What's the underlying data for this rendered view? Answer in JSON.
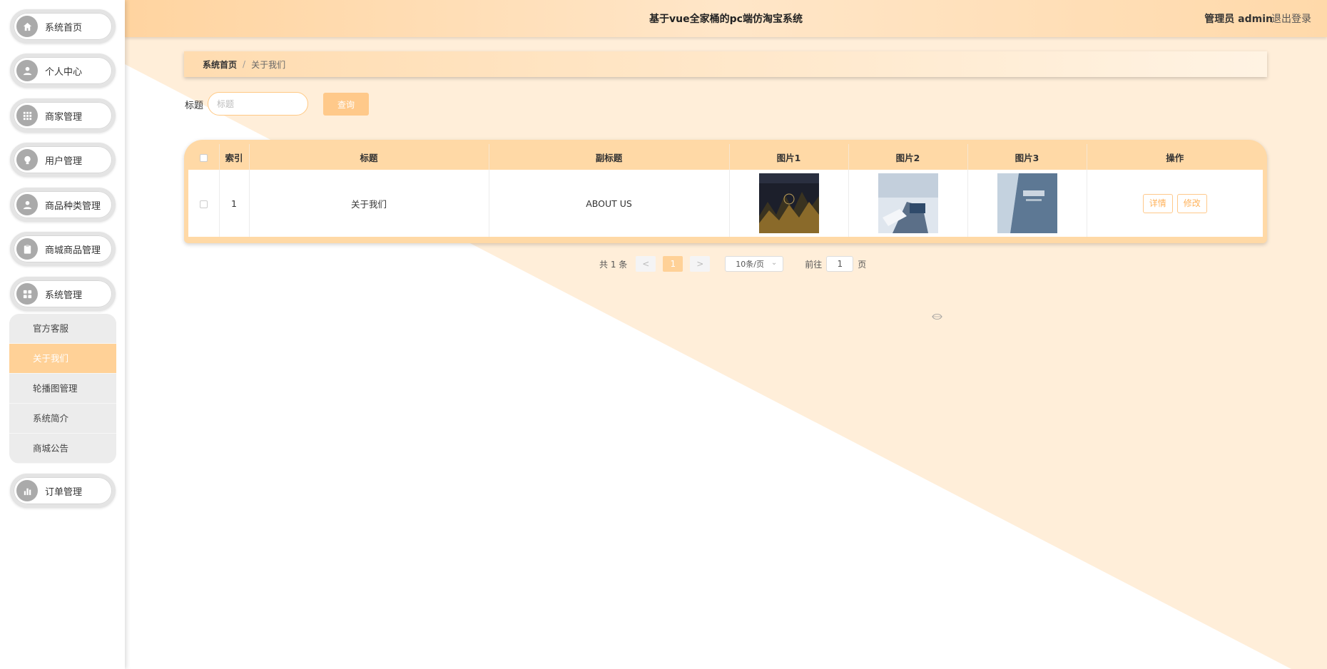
{
  "header": {
    "title": "基于vue全家桶的pc端仿淘宝系统",
    "user": "管理员 admin",
    "logout": "退出登录"
  },
  "sidebar": {
    "items": [
      {
        "label": "系统首页",
        "icon": "home-icon"
      },
      {
        "label": "个人中心",
        "icon": "user-icon"
      },
      {
        "label": "商家管理",
        "icon": "grid-icon"
      },
      {
        "label": "用户管理",
        "icon": "bulb-icon"
      },
      {
        "label": "商品种类管理",
        "icon": "user-icon"
      },
      {
        "label": "商城商品管理",
        "icon": "clipboard-icon"
      },
      {
        "label": "系统管理",
        "icon": "apps-icon"
      },
      {
        "label": "订单管理",
        "icon": "bar-chart-icon"
      }
    ],
    "submenu": [
      {
        "label": "官方客服"
      },
      {
        "label": "关于我们",
        "active": true
      },
      {
        "label": "轮播图管理"
      },
      {
        "label": "系统简介"
      },
      {
        "label": "商城公告"
      }
    ]
  },
  "breadcrumb": {
    "home": "系统首页",
    "separator": "/",
    "current": "关于我们"
  },
  "search": {
    "label": "标题",
    "placeholder": "标题",
    "button": "查询"
  },
  "table": {
    "columns": [
      "索引",
      "标题",
      "副标题",
      "图片1",
      "图片2",
      "图片3",
      "操作"
    ],
    "rows": [
      {
        "index": "1",
        "title": "关于我们",
        "subtitle": "ABOUT US",
        "detail_label": "详情",
        "edit_label": "修改"
      }
    ]
  },
  "pagination": {
    "total": "共 1 条",
    "prev": "<",
    "current_page": "1",
    "next": ">",
    "page_size": "10条/页",
    "goto_label": "前往",
    "goto_value": "1",
    "page_unit": "页"
  },
  "colors": {
    "accent": "#ffd197",
    "header_bg": "#ffe0b8",
    "button": "#ffc98a"
  }
}
